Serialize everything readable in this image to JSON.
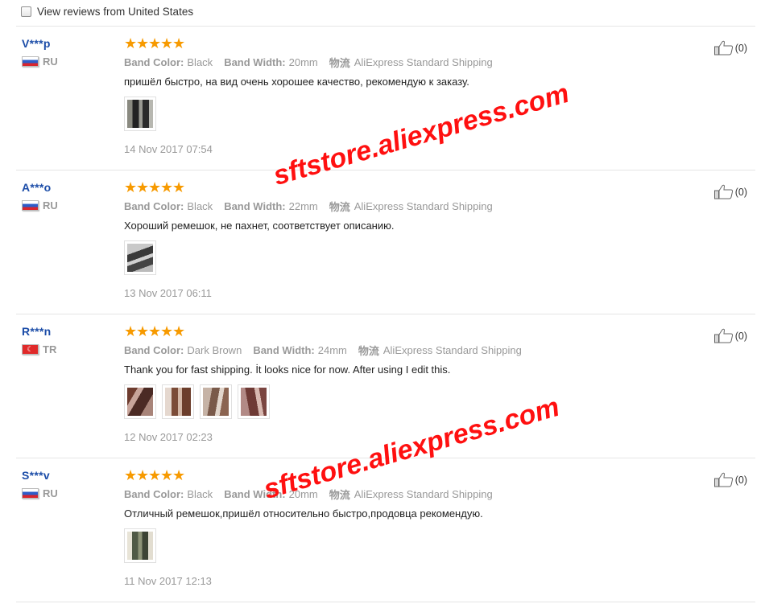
{
  "filter": {
    "label": "View reviews from United States"
  },
  "labels": {
    "color": "Band Color:",
    "width": "Band Width:",
    "shipping_glyph": "物流"
  },
  "rating_stars": "★★★★★",
  "watermark": "sftstore.aliexpress.com",
  "reviews": [
    {
      "user": "V***p",
      "country": "RU",
      "rating": 5,
      "color": "Black",
      "width": "20mm",
      "shipping": "AliExpress Standard Shipping",
      "text": "пришёл быстро, на вид очень хорошее качество, рекомендую к заказу.",
      "date": "14 Nov 2017 07:54",
      "helpful": "(0)"
    },
    {
      "user": "A***o",
      "country": "RU",
      "rating": 5,
      "color": "Black",
      "width": "22mm",
      "shipping": "AliExpress Standard Shipping",
      "text": "Хороший ремешок, не пахнет, соответствует описанию.",
      "date": "13 Nov 2017 06:11",
      "helpful": "(0)"
    },
    {
      "user": "R***n",
      "country": "TR",
      "rating": 5,
      "color": "Dark Brown",
      "width": "24mm",
      "shipping": "AliExpress Standard Shipping",
      "text": "Thank you for fast shipping. İt looks nice for now. After using I edit this.",
      "date": "12 Nov 2017 02:23",
      "helpful": "(0)"
    },
    {
      "user": "S***v",
      "country": "RU",
      "rating": 5,
      "color": "Black",
      "width": "20mm",
      "shipping": "AliExpress Standard Shipping",
      "text": "Отличный ремешок,пришёл относительно быстро,продовца рекомендую.",
      "date": "11 Nov 2017 12:13",
      "helpful": "(0)"
    }
  ]
}
